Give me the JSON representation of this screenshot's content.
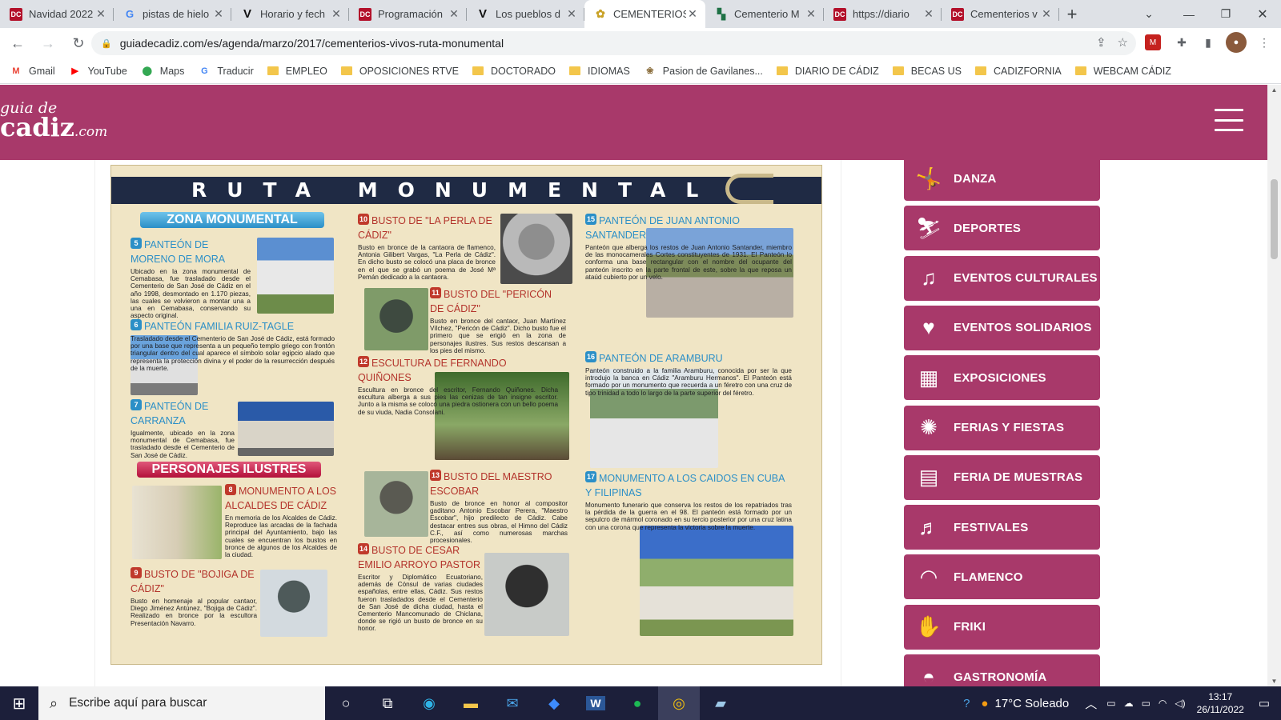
{
  "browser": {
    "tabs": [
      {
        "title": "Navidad 2022",
        "icon": "dc-icon",
        "favtext": "DC"
      },
      {
        "title": "pistas de hielo",
        "icon": "google-icon",
        "favtext": "G"
      },
      {
        "title": "Horario y fech",
        "icon": "v-icon",
        "favtext": "V"
      },
      {
        "title": "Programación",
        "icon": "dc-icon",
        "favtext": "DC"
      },
      {
        "title": "Los pueblos d",
        "icon": "v-icon",
        "favtext": "V"
      },
      {
        "title": "CEMENTERIOS",
        "icon": "guia-icon",
        "favtext": "✿",
        "active": true
      },
      {
        "title": "Cementerio M",
        "icon": "excel-icon",
        "favtext": "▚"
      },
      {
        "title": "https://diario",
        "icon": "dc-icon",
        "favtext": "DC"
      },
      {
        "title": "Cementerios v",
        "icon": "dc-icon",
        "favtext": "DC"
      }
    ],
    "url": "guiadecadiz.com/es/agenda/marzo/2017/cementerios-vivos-ruta-monumental",
    "bookmarks": [
      "Gmail",
      "YouTube",
      "Maps",
      "Traducir",
      "EMPLEO",
      "OPOSICIONES RTVE",
      "DOCTORADO",
      "IDIOMAS",
      "Pasion de Gavilanes...",
      "DIARIO DE CÁDIZ",
      "BECAS US",
      "CADIZFORNIA",
      "WEBCAM CÁDIZ"
    ]
  },
  "site": {
    "logo_line1": "guia de",
    "logo_line2": "cadiz",
    "logo_line3": ".com",
    "brand_color": "#a8396a"
  },
  "guide": {
    "title": "RUTA MONUMENTAL",
    "section_monumental": "ZONA MONUMENTAL",
    "section_personajes": "PERSONAJES ILUSTRES",
    "items": [
      {
        "n": "5",
        "h": "PANTEÓN DE MORENO DE MORA",
        "t": "Ubicado en la zona monumental de Cemabasa, fue trasladado desde el Cementerio de San José de Cádiz en el año 1998, desmontado en 1.170 piezas, las cuales se volvieron a montar una a una en Cemabasa, conservando su aspecto original."
      },
      {
        "n": "6",
        "h": "PANTEÓN FAMILIA RUIZ-TAGLE",
        "t": "Trasladado desde el Cementerio de San José de Cádiz, está formado por una base que representa a un pequeño templo griego con frontón triangular dentro del cual aparece el símbolo solar egipcio alado que representa la protección divina y el poder de la resurrección después de la muerte."
      },
      {
        "n": "7",
        "h": "PANTEÓN DE CARRANZA",
        "t": "Igualmente, ubicado en la zona monumental de Cemabasa, fue trasladado desde el Cementerio de San José de Cádiz."
      },
      {
        "n": "8",
        "h": "MONUMENTO A LOS ALCALDES DE CÁDIZ",
        "t": "En memoria de los Alcaldes de Cádiz. Reproduce las arcadas de la fachada principal del Ayuntamiento, bajo las cuales se encuentran los bustos en bronce de algunos de los Alcaldes de la ciudad."
      },
      {
        "n": "9",
        "h": "BUSTO DE \"BOJIGA DE CÁDIZ\"",
        "t": "Busto en homenaje al popular cantaor, Diego Jiménez Antúnez, \"Bojiga de Cádiz\". Realizado en bronce por la escultora Presentación Navarro."
      },
      {
        "n": "10",
        "h": "BUSTO DE \"LA PERLA DE CÁDIZ\"",
        "t": "Busto en bronce de la cantaora de flamenco, Antonia Gilibert Vargas, \"La Perla de Cádiz\". En dicho busto se colocó una placa de bronce en el que se grabó un poema de José Mª Pemán dedicado a la cantaora."
      },
      {
        "n": "11",
        "h": "BUSTO DEL \"PERICÓN DE CÁDIZ\"",
        "t": "Busto en bronce del cantaor, Juan Martínez Vílchez, \"Pericón de Cádiz\". Dicho busto fue el primero que se erigió en la zona de personajes ilustres. Sus restos descansan a los pies del mismo."
      },
      {
        "n": "12",
        "h": "ESCULTURA DE FERNANDO QUIÑONES",
        "t": "Escultura en bronce del escritor, Fernando Quiñones. Dicha escultura alberga a sus pies las cenizas de tan insigne escritor. Junto a la misma se colocó una piedra ostionera con un bello poema de su viuda, Nadia Consolani."
      },
      {
        "n": "13",
        "h": "BUSTO DEL MAESTRO ESCOBAR",
        "t": "Busto de bronce en honor al compositor gaditano Antonio Escobar Perera, \"Maestro Escobar\", hijo predilecto de Cádiz. Cabe destacar entres sus obras, el Himno del Cádiz C.F., así como numerosas marchas procesionales."
      },
      {
        "n": "14",
        "h": "BUSTO DE CESAR EMILIO ARROYO PASTOR",
        "t": "Escritor y Diplomático Ecuatoriano, además de Cónsul de varias ciudades españolas, entre ellas, Cádiz. Sus restos fueron trasladados desde el Cementerio de San José de dicha ciudad, hasta el Cementerio Mancomunado de Chiclana, donde se rigió un busto de bronce en su honor."
      },
      {
        "n": "15",
        "h": "PANTEÓN DE JUAN ANTONIO SANTANDER",
        "t": "Panteón que alberga los restos de Juan Antonio Santander, miembro de las monocamerales Cortes constituyentes de 1931. El Panteón lo conforma una base rectangular con el nombre del ocupante del panteón inscrito en la parte frontal de este, sobre la que reposa un ataúd cubierto por un velo."
      },
      {
        "n": "16",
        "h": "PANTEÓN DE ARAMBURU",
        "t": "Panteón construido a la familia Aramburu, conocida por ser la que introdujo la banca en Cádiz \"Aramburu Hermanos\". El Panteón está formado por un monumento que recuerda a un féretro con una cruz de tipo trinidad a todo lo largo de la parte superior del féretro."
      },
      {
        "n": "17",
        "h": "MONUMENTO A LOS CAIDOS EN CUBA Y FILIPINAS",
        "t": "Monumento funerario que conserva los restos de los repatriados tras la pérdida de la guerra en el 98. El panteón está formado por un sepulcro de mármol coronado en su tercio posterior por una cruz latina con una corona que representa la victoria sobre la muerte."
      }
    ]
  },
  "sidebar": {
    "categories": [
      {
        "label": "DANZA",
        "icon": "dance-icon",
        "glyph": "🤸"
      },
      {
        "label": "DEPORTES",
        "icon": "sports-icon",
        "glyph": "⛷"
      },
      {
        "label": "EVENTOS CULTURALES",
        "icon": "lyre-icon",
        "glyph": "♫"
      },
      {
        "label": "EVENTOS SOLIDARIOS",
        "icon": "heart-hands-icon",
        "glyph": "♥"
      },
      {
        "label": "EXPOSICIONES",
        "icon": "easel-icon",
        "glyph": "▦"
      },
      {
        "label": "FERIAS Y FIESTAS",
        "icon": "fireworks-icon",
        "glyph": "✺"
      },
      {
        "label": "FERIA DE MUESTRAS",
        "icon": "presentation-icon",
        "glyph": "▤"
      },
      {
        "label": "FESTIVALES",
        "icon": "stage-icon",
        "glyph": "♬"
      },
      {
        "label": "FLAMENCO",
        "icon": "fan-icon",
        "glyph": "◠"
      },
      {
        "label": "FRIKI",
        "icon": "vulcan-hand-icon",
        "glyph": "✋"
      },
      {
        "label": "GASTRONOMÍA",
        "icon": "dish-icon",
        "glyph": "◓"
      }
    ]
  },
  "taskbar": {
    "search_placeholder": "Escribe aquí para buscar",
    "weather": "17°C Soleado",
    "time": "13:17",
    "date": "26/11/2022"
  }
}
